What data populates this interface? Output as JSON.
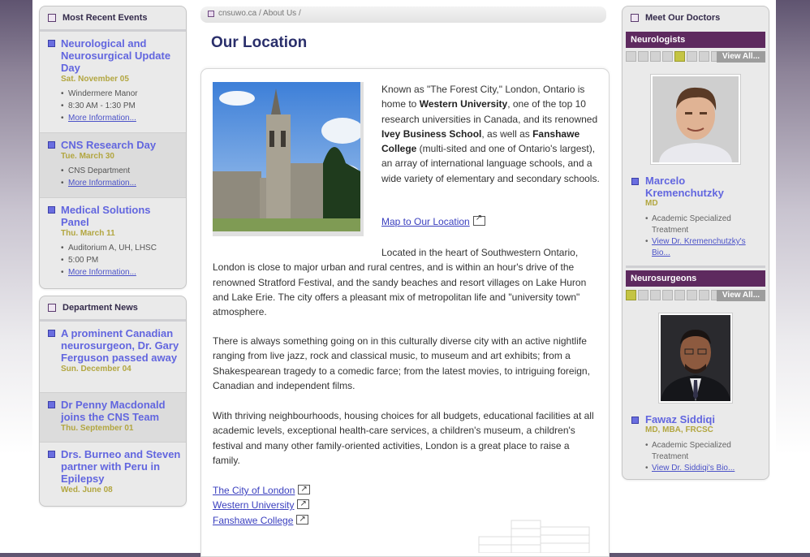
{
  "breadcrumb": "cnsuwo.ca / About Us /",
  "page_title": "Our Location",
  "events": {
    "header": "Most Recent Events",
    "items": [
      {
        "title": "Neurological and Neurosurgical Update Day",
        "date": "Sat. November 05",
        "details": [
          "Windermere Manor",
          "8:30 AM - 1:30 PM"
        ],
        "more": "More Information..."
      },
      {
        "title": "CNS Research Day",
        "date": "Tue. March 30",
        "details": [
          "CNS Department"
        ],
        "more": "More Information..."
      },
      {
        "title": "Medical Solutions Panel",
        "date": "Thu. March 11",
        "details": [
          "Auditorium A, UH, LHSC",
          "5:00 PM"
        ],
        "more": "More Information..."
      }
    ]
  },
  "news": {
    "header": "Department News",
    "items": [
      {
        "title": "A prominent Canadian neurosurgeon, Dr. Gary Ferguson passed away",
        "date": "Sun. December 04"
      },
      {
        "title": "Dr Penny Macdonald joins the CNS Team",
        "date": "Thu. September 01"
      },
      {
        "title": "Drs. Burneo and Steven partner with Peru in Epilepsy",
        "date": "Wed. June 08"
      }
    ]
  },
  "content": {
    "intro_parts": [
      "Known as \"The Forest City,\" London, Ontario is home to ",
      "Western University",
      ", one of the top 10 research universities in Canada, and its renowned ",
      "Ivey Business School",
      ", as well as ",
      "Fanshawe College",
      " (multi-sited and one of Ontario's largest), an array of international language schools, and a wide variety of elementary and secondary schools."
    ],
    "map_link": "Map to Our Location",
    "para1": "Located in the heart of Southwestern Ontario, London is close to major urban and rural centres, and is within an hour's drive of the renowned Stratford Festival, and the sandy beaches and resort villages on Lake Huron and Lake Erie. The city offers a pleasant mix of metropolitan life and \"university town\" atmosphere.",
    "para2": "There is always something going on in this culturally diverse city with an active nightlife ranging from live jazz, rock and classical music, to museum and art exhibits; from a Shakespearean tragedy to a comedic farce; from the latest movies, to intriguing foreign, Canadian and independent films.",
    "para3": "With thriving neighbourhoods, housing choices for all budgets, educational facilities at all academic levels, exceptional health-care services, a children's museum, a children's festival and many other family-oriented activities, London is a great place to raise a family.",
    "links": [
      "The City of London",
      "Western University",
      "Fanshawe College"
    ]
  },
  "doctors": {
    "header": "Meet Our Doctors",
    "view_all": "View All...",
    "groups": [
      {
        "category": "Neurologists",
        "active_index": 4,
        "count": 8,
        "name": "Marcelo Kremenchutzky",
        "cred": "MD",
        "specialty": "Academic Specialized Treatment",
        "bio": "View Dr. Kremenchutzky's Bio..."
      },
      {
        "category": "Neurosurgeons",
        "active_index": 0,
        "count": 8,
        "name": "Fawaz Siddiqi",
        "cred": "MD, MBA, FRCSC",
        "specialty": "Academic Specialized Treatment",
        "bio": "View Dr. Siddiqi's Bio..."
      }
    ]
  }
}
